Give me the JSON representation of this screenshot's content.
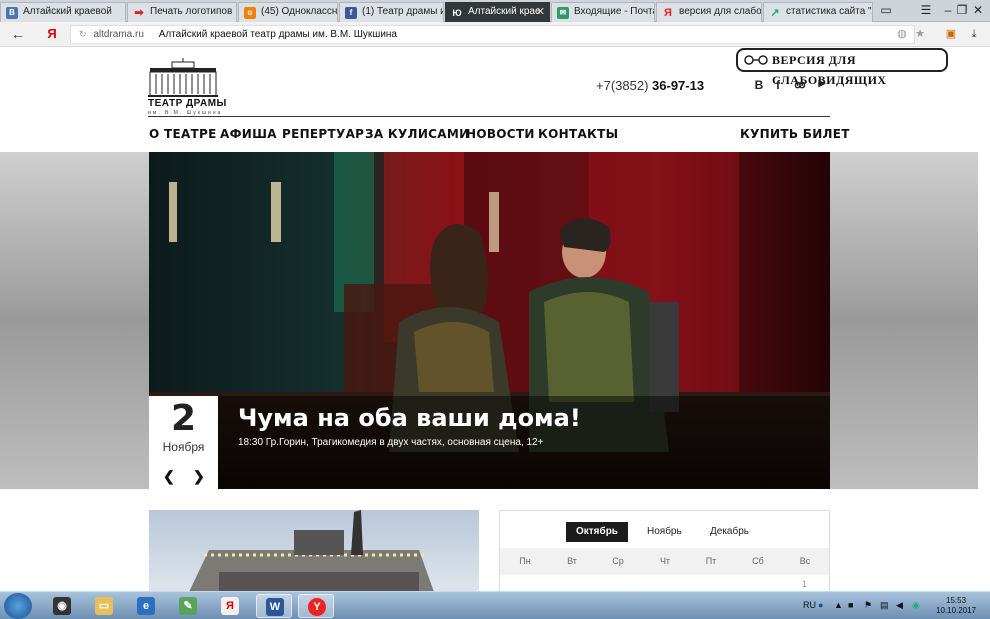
{
  "browser": {
    "tabs": [
      {
        "label": "Алтайский краевой",
        "icon": "vk-icon",
        "color": "#4a76a8"
      },
      {
        "label": "Печать логотипов",
        "icon": "red-arrow-icon",
        "color": "#d22"
      },
      {
        "label": "(45) Одноклассник",
        "icon": "ok-icon",
        "color": "#ee8208"
      },
      {
        "label": "(1) Театр драмы им",
        "icon": "facebook-icon",
        "color": "#3b5998"
      },
      {
        "label": "Алтайский крае",
        "icon": "theatre-icon",
        "color": "#222"
      },
      {
        "label": "Входящие - Почта",
        "icon": "mail-icon",
        "color": "#2c9b6b"
      },
      {
        "label": "версия для слабов",
        "icon": "yandex-icon",
        "color": "#e22"
      },
      {
        "label": "статистика сайта \"А",
        "icon": "chart-icon",
        "color": "#2a7"
      }
    ],
    "address": {
      "domain": "altdrama.ru",
      "title": "Алтайский краевой театр драмы им. В.М. Шукшина"
    },
    "yandex_button": "Я"
  },
  "site": {
    "logo_text": "ТЕАТР ДРАМЫ",
    "logo_sub": "им. В.М. Шукшина",
    "phone_prefix": "+7(3852)",
    "phone_number": "36-97-13",
    "vision_button": "ВЕРСИЯ ДЛЯ СЛАБОВИДЯЩИХ",
    "social": [
      "В",
      "f",
      "ok",
      "yt"
    ],
    "menu": [
      "О ТЕАТРЕ",
      "АФИША",
      "РЕПЕРТУАР",
      "ЗА КУЛИСАМИ",
      "НОВОСТИ",
      "КОНТАКТЫ"
    ],
    "buy_ticket": "КУПИТЬ БИЛЕТ"
  },
  "hero": {
    "day": "2",
    "month": "Ноября",
    "title": "Чума на оба ваши дома!",
    "subtitle": "18:30 Гр.Горин, Трагикомедия в двух частях, основная сцена, 12+"
  },
  "calendar": {
    "months": [
      "Октябрь",
      "Ноябрь",
      "Декабрь"
    ],
    "weekdays": [
      "Пн",
      "Вт",
      "Ср",
      "Чт",
      "Пт",
      "Сб",
      "Вс"
    ],
    "first_day": "1"
  },
  "taskbar": {
    "lang": "RU",
    "time": "15:53",
    "date": "10.10.2017"
  }
}
